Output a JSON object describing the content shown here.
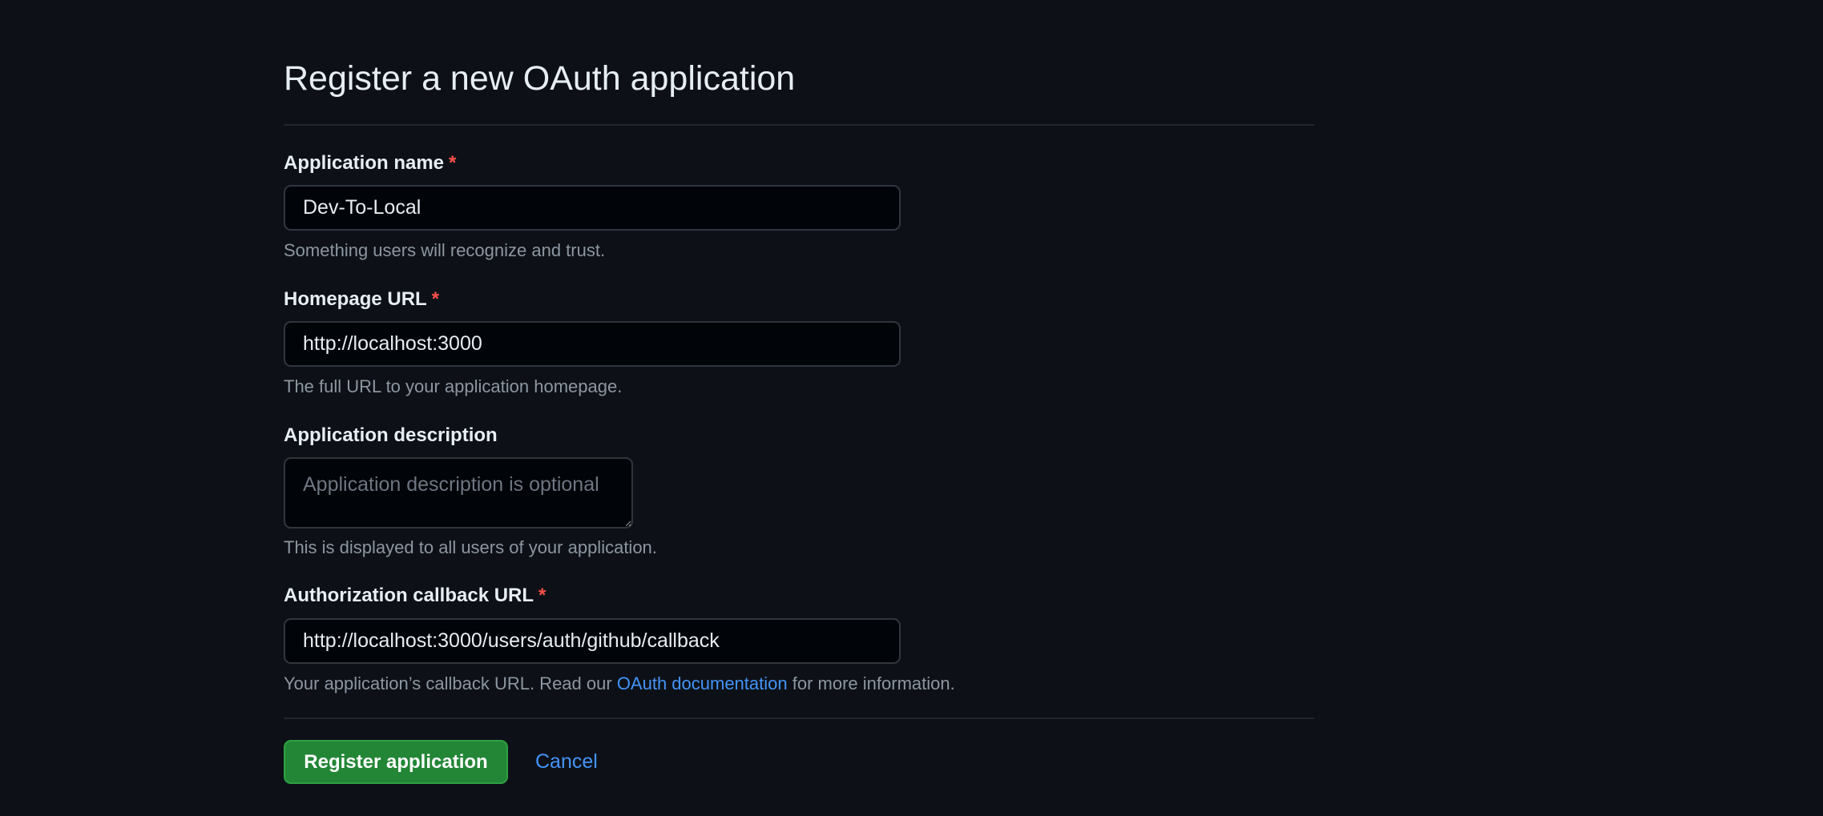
{
  "page": {
    "title": "Register a new OAuth application"
  },
  "fields": {
    "app_name": {
      "label": "Application name",
      "required_mark": "*",
      "value": "Dev-To-Local",
      "hint": "Something users will recognize and trust."
    },
    "homepage_url": {
      "label": "Homepage URL",
      "required_mark": "*",
      "value": "http://localhost:3000",
      "hint": "The full URL to your application homepage."
    },
    "description": {
      "label": "Application description",
      "placeholder": "Application description is optional",
      "value": "",
      "hint": "This is displayed to all users of your application."
    },
    "callback_url": {
      "label": "Authorization callback URL",
      "required_mark": "*",
      "value": "http://localhost:3000/users/auth/github/callback",
      "hint_before": "Your application’s callback URL. Read our",
      "hint_link": "OAuth documentation",
      "hint_after": "for more information."
    }
  },
  "actions": {
    "submit_label": "Register application",
    "cancel_label": "Cancel"
  },
  "colors": {
    "background": "#0d1117",
    "input_background": "#010409",
    "border": "#30363d",
    "primary_button": "#238636",
    "link": "#4493f8",
    "required": "#f85149"
  }
}
